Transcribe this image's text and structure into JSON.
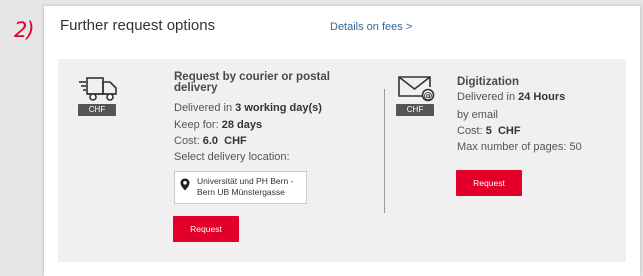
{
  "step_marker": "2)",
  "header": {
    "title": "Further request options",
    "fees_link": "Details on fees >"
  },
  "courier": {
    "icon": "truck-icon",
    "badge": "CHF",
    "title": "Request by courier or postal delivery",
    "delivered_prefix": "Delivered in ",
    "delivered_value": "3 working day(s)",
    "keep_prefix": "Keep for: ",
    "keep_value": "28 days",
    "cost_prefix": "Cost: ",
    "cost_value": "6.0  CHF",
    "location_label": "Select delivery location:",
    "location_value": "Universität und PH Bern - Bern UB Münstergasse",
    "request_button": "Request"
  },
  "digitization": {
    "icon": "email-icon",
    "badge": "CHF",
    "title": "Digitization",
    "delivered_prefix": "Delivered in ",
    "delivered_value": "24 Hours",
    "by_line": "by email",
    "cost_prefix": "Cost: ",
    "cost_value": "5  CHF",
    "pages_prefix": "Max number of pages: ",
    "pages_value": "50",
    "request_button": "Request"
  },
  "colors": {
    "accent": "#e2002a",
    "link": "#336699",
    "panel": "#f0f0f0",
    "page": "#e6e6e6"
  }
}
